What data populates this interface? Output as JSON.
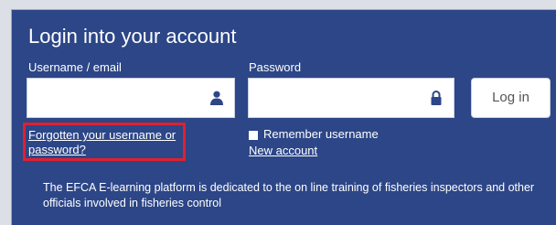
{
  "login": {
    "title": "Login into your account",
    "username_label": "Username / email",
    "username_value": "",
    "username_icon": "user-icon",
    "password_label": "Password",
    "password_value": "",
    "password_icon": "lock-icon",
    "login_button": "Log in",
    "forgotten_link": "Forgotten your username or password?",
    "remember_label": "Remember username",
    "remember_checked": false,
    "new_account_link": "New account",
    "info_text": "The EFCA E-learning platform is dedicated to the on line training of fisheries inspectors and other officials involved in fisheries control"
  },
  "colors": {
    "panel_bg": "#2c4687",
    "highlight_border": "#e0202e",
    "text": "#ffffff"
  }
}
